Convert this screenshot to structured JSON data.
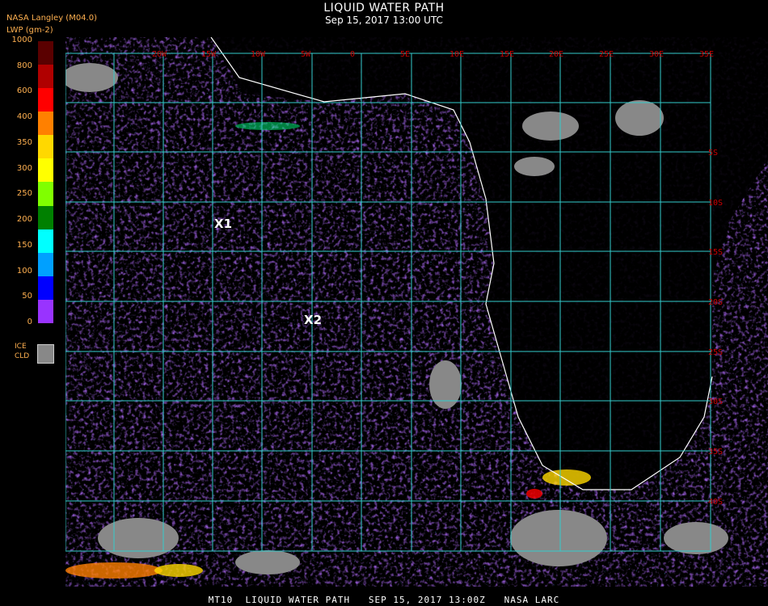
{
  "header": {
    "title": "LIQUID WATER PATH",
    "subtitle": "Sep 15, 2017 13:00 UTC",
    "org": "NASA Langley (M04.0)",
    "unit": "LWP (gm-2)"
  },
  "legend": {
    "labels": [
      "1000",
      "800",
      "600",
      "400",
      "350",
      "300",
      "250",
      "200",
      "150",
      "100",
      "50",
      "0"
    ],
    "colors": [
      "#5a0000",
      "#b00000",
      "#ff0000",
      "#ff8000",
      "#ffd800",
      "#ffff00",
      "#80ff00",
      "#008000",
      "#00ffff",
      "#00a0ff",
      "#0000ff",
      "#9933ff"
    ],
    "ice_label_1": "ICE",
    "ice_label_2": "CLD",
    "ice_color": "#888888"
  },
  "map": {
    "lon_labels": [
      "20W",
      "15W",
      "10W",
      "5W",
      "0",
      "5E",
      "10E",
      "15E",
      "20E",
      "25E",
      "30E",
      "35E"
    ],
    "lat_labels": [
      "5S",
      "10S",
      "15S",
      "20S",
      "25S",
      "30S",
      "35S",
      "40S"
    ],
    "markers": [
      {
        "label": "X1"
      },
      {
        "label": "X2"
      }
    ]
  },
  "footer": "MT10  LIQUID WATER PATH   SEP 15, 2017 13:00Z   NASA LARC"
}
